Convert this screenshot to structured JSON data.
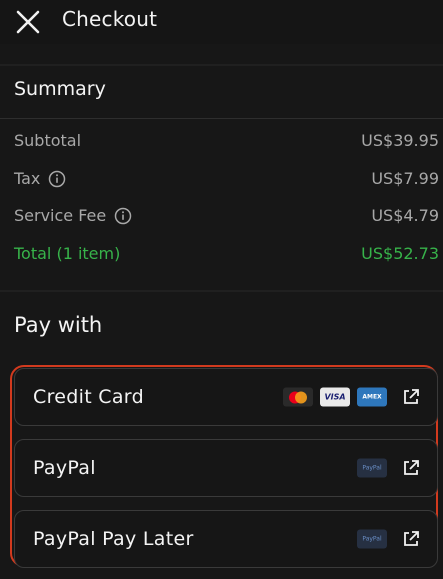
{
  "header": {
    "title": "Checkout",
    "close_icon": "close-icon"
  },
  "summary": {
    "title": "Summary",
    "rows": [
      {
        "label": "Subtotal",
        "value": "US$39.95",
        "info": false
      },
      {
        "label": "Tax",
        "value": "US$7.99",
        "info": true
      },
      {
        "label": "Service Fee",
        "value": "US$4.79",
        "info": true
      }
    ],
    "total": {
      "label": "Total (1 item)",
      "value": "US$52.73"
    }
  },
  "pay_with": {
    "title": "Pay with",
    "options": [
      {
        "label": "Credit Card",
        "icons": [
          "mastercard-icon",
          "visa-icon",
          "amex-icon"
        ],
        "visa_text": "VISA",
        "amex_text": "AMEX"
      },
      {
        "label": "PayPal",
        "icons": [
          "paypal-icon"
        ],
        "badge_text": "PayPal"
      },
      {
        "label": "PayPal Pay Later",
        "icons": [
          "paypal-icon"
        ],
        "badge_text": "PayPal"
      }
    ]
  },
  "colors": {
    "background": "#171717",
    "total_green": "#37b34a",
    "highlight_border": "#d23a1e",
    "muted_text": "#a8a8a8"
  }
}
